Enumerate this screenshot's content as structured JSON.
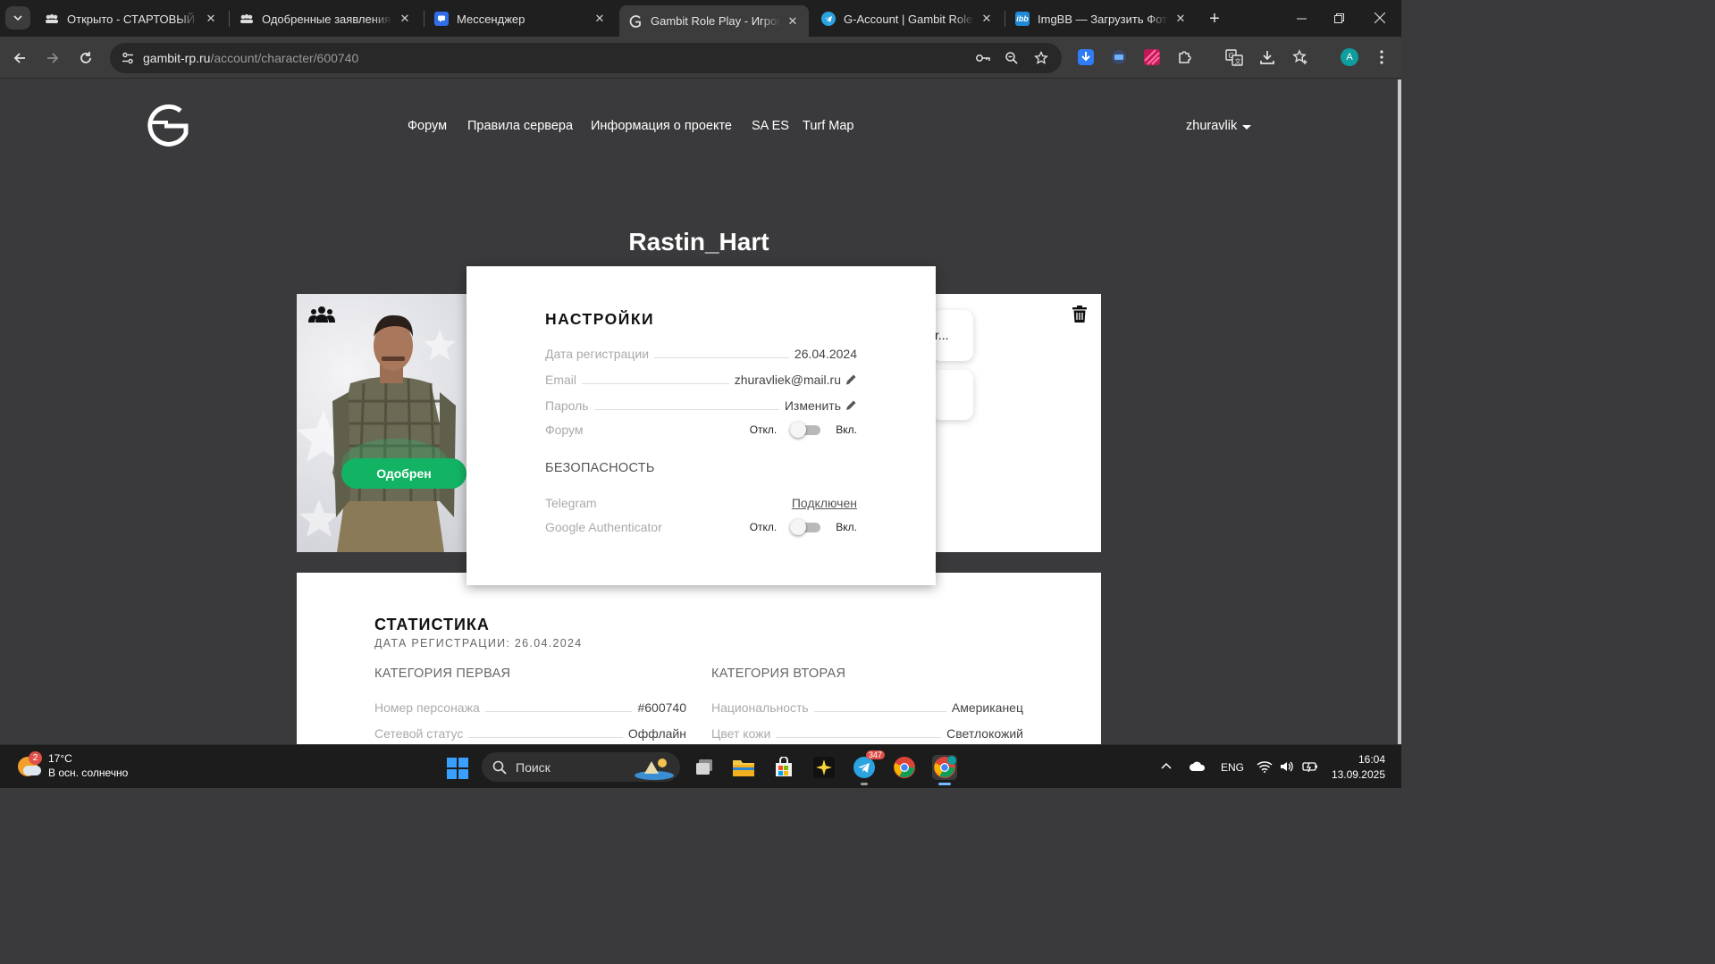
{
  "browser": {
    "tabs": [
      {
        "title": "Открыто - СТАРТОВЫЙ СО",
        "favicon": "forum-icon",
        "active": false
      },
      {
        "title": "Одобренные заявления | S",
        "favicon": "forum-icon",
        "active": false
      },
      {
        "title": "Мессенджер",
        "favicon": "messenger-icon",
        "active": false
      },
      {
        "title": "Gambit Role Play - Игрово",
        "favicon": "gambit-icon",
        "active": true
      },
      {
        "title": "G-Account | Gambit Role P",
        "favicon": "telegram-icon",
        "active": false
      },
      {
        "title": "ImgBB — Загрузить Фото",
        "favicon": "imgbb-icon",
        "active": false
      }
    ],
    "url_host": "gambit-rp.ru",
    "url_path": "/account/character/600740",
    "profile_initial": "A"
  },
  "site": {
    "nav": [
      "Форум",
      "Правила сервера",
      "Информация о проекте",
      "SA ES",
      "Turf Map"
    ],
    "username": "zhuravlik"
  },
  "character": {
    "name": "Rastin_Hart",
    "status_badge": "Одобрен",
    "mini_card_text": "r..."
  },
  "settings_modal": {
    "title": "НАСТРОЙКИ",
    "rows": [
      {
        "label": "Дата регистрации",
        "value": "26.04.2024"
      },
      {
        "label": "Email",
        "value": "zhuravliek@mail.ru"
      },
      {
        "label": "Пароль",
        "value": "Изменить"
      }
    ],
    "forum": {
      "label": "Форум",
      "off": "Откл.",
      "on": "Вкл."
    },
    "security_title": "БЕЗОПАСНОСТЬ",
    "telegram": {
      "label": "Telegram",
      "value": "Подключен"
    },
    "google_auth": {
      "label": "Google Authenticator",
      "off": "Откл.",
      "on": "Вкл."
    }
  },
  "stats": {
    "title": "СТАТИСТИКА",
    "subtitle": "ДАТА РЕГИСТРАЦИИ: 26.04.2024",
    "category1": {
      "title": "КАТЕГОРИЯ ПЕРВАЯ",
      "rows": [
        {
          "label": "Номер персонажа",
          "value": "#600740"
        },
        {
          "label": "Сетевой статус",
          "value": "Оффлайн"
        }
      ]
    },
    "category2": {
      "title": "КАТЕГОРИЯ ВТОРАЯ",
      "rows": [
        {
          "label": "Национальность",
          "value": "Американец"
        },
        {
          "label": "Цвет кожи",
          "value": "Светлокожий"
        }
      ]
    }
  },
  "taskbar": {
    "weather_temp": "17°C",
    "weather_desc": "В осн. солнечно",
    "weather_badge": "2",
    "search_label": "Поиск",
    "telegram_badge": "347",
    "language": "ENG",
    "time": "16:04",
    "date": "13.09.2025"
  },
  "colors": {
    "page_bg": "#3a3a3c",
    "approved_green": "#12b464",
    "chrome_bg": "#1f1f1f"
  }
}
